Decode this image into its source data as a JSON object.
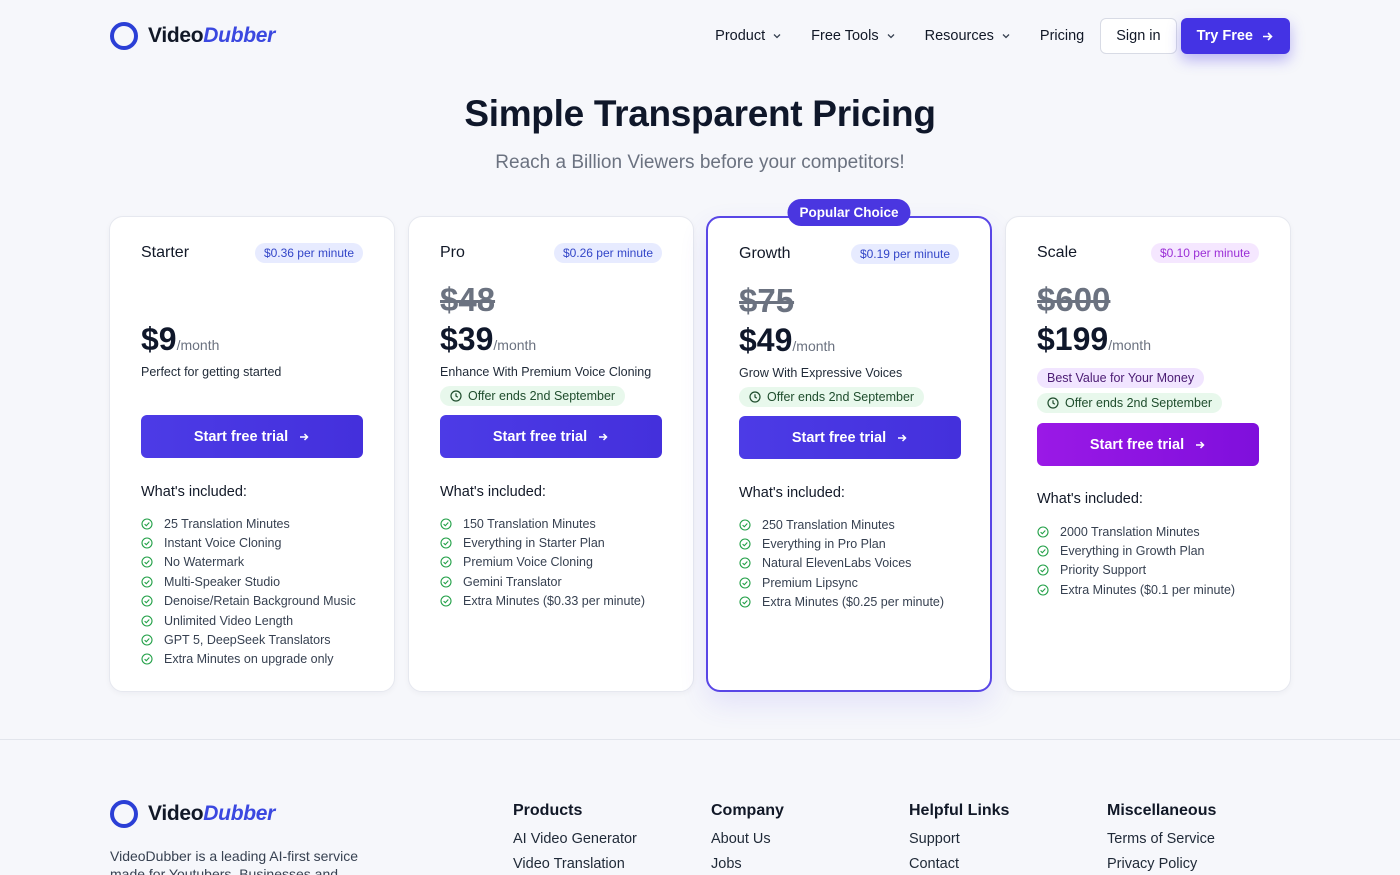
{
  "brand": {
    "name_part1": "Video",
    "name_part2": "Dubber"
  },
  "nav": {
    "items": [
      "Product",
      "Free Tools",
      "Resources"
    ],
    "pricing": "Pricing",
    "signin": "Sign in",
    "tryfree": "Try Free"
  },
  "hero": {
    "title": "Simple Transparent Pricing",
    "subtitle": "Reach a Billion Viewers before your competitors!"
  },
  "plans": [
    {
      "name": "Starter",
      "rate": "$0.36 per minute",
      "old_price": "",
      "price": "$9",
      "period": "/month",
      "tagline": "Perfect for getting started",
      "badge": "",
      "offer": "",
      "cta": "Start free trial",
      "included": "What's included:",
      "features": [
        "25 Translation Minutes",
        "Instant Voice Cloning",
        "No Watermark",
        "Multi-Speaker Studio",
        "Denoise/Retain Background Music",
        "Unlimited Video Length",
        "GPT 5, DeepSeek Translators",
        "Extra Minutes on upgrade only"
      ]
    },
    {
      "name": "Pro",
      "rate": "$0.26 per minute",
      "old_price": "$48",
      "price": "$39",
      "period": "/month",
      "tagline": "Enhance With Premium Voice Cloning",
      "badge": "",
      "offer": "Offer ends 2nd September",
      "cta": "Start free trial",
      "included": "What's included:",
      "features": [
        "150 Translation Minutes",
        "Everything in Starter Plan",
        "Premium Voice Cloning",
        "Gemini Translator",
        "Extra Minutes ($0.33 per minute)"
      ]
    },
    {
      "name": "Growth",
      "rate": "$0.19 per minute",
      "old_price": "$75",
      "price": "$49",
      "period": "/month",
      "tagline": "Grow With Expressive Voices",
      "badge": "Popular Choice",
      "offer": "Offer ends 2nd September",
      "cta": "Start free trial",
      "included": "What's included:",
      "features": [
        "250 Translation Minutes",
        "Everything in Pro Plan",
        "Natural ElevenLabs Voices",
        "Premium Lipsync",
        "Extra Minutes ($0.25 per minute)"
      ]
    },
    {
      "name": "Scale",
      "rate": "$0.10 per minute",
      "old_price": "$600",
      "price": "$199",
      "period": "/month",
      "tagline": "",
      "badge": "Best Value for Your Money",
      "offer": "Offer ends 2nd September",
      "cta": "Start free trial",
      "included": "What's included:",
      "features": [
        "2000 Translation Minutes",
        "Everything in Growth Plan",
        "Priority Support",
        "Extra Minutes ($0.1 per minute)"
      ]
    }
  ],
  "footer": {
    "description": "VideoDubber is a leading AI-first service made for Youtubers, Businesses and",
    "columns": [
      {
        "title": "Products",
        "links": [
          "AI Video Generator",
          "Video Translation"
        ]
      },
      {
        "title": "Company",
        "links": [
          "About Us",
          "Jobs"
        ]
      },
      {
        "title": "Helpful Links",
        "links": [
          "Support",
          "Contact"
        ]
      },
      {
        "title": "Miscellaneous",
        "links": [
          "Terms of Service",
          "Privacy Policy"
        ]
      }
    ]
  },
  "colors": {
    "primary": "#4433e4",
    "accent_purple": "#8e14e1",
    "success": "#22a047"
  }
}
